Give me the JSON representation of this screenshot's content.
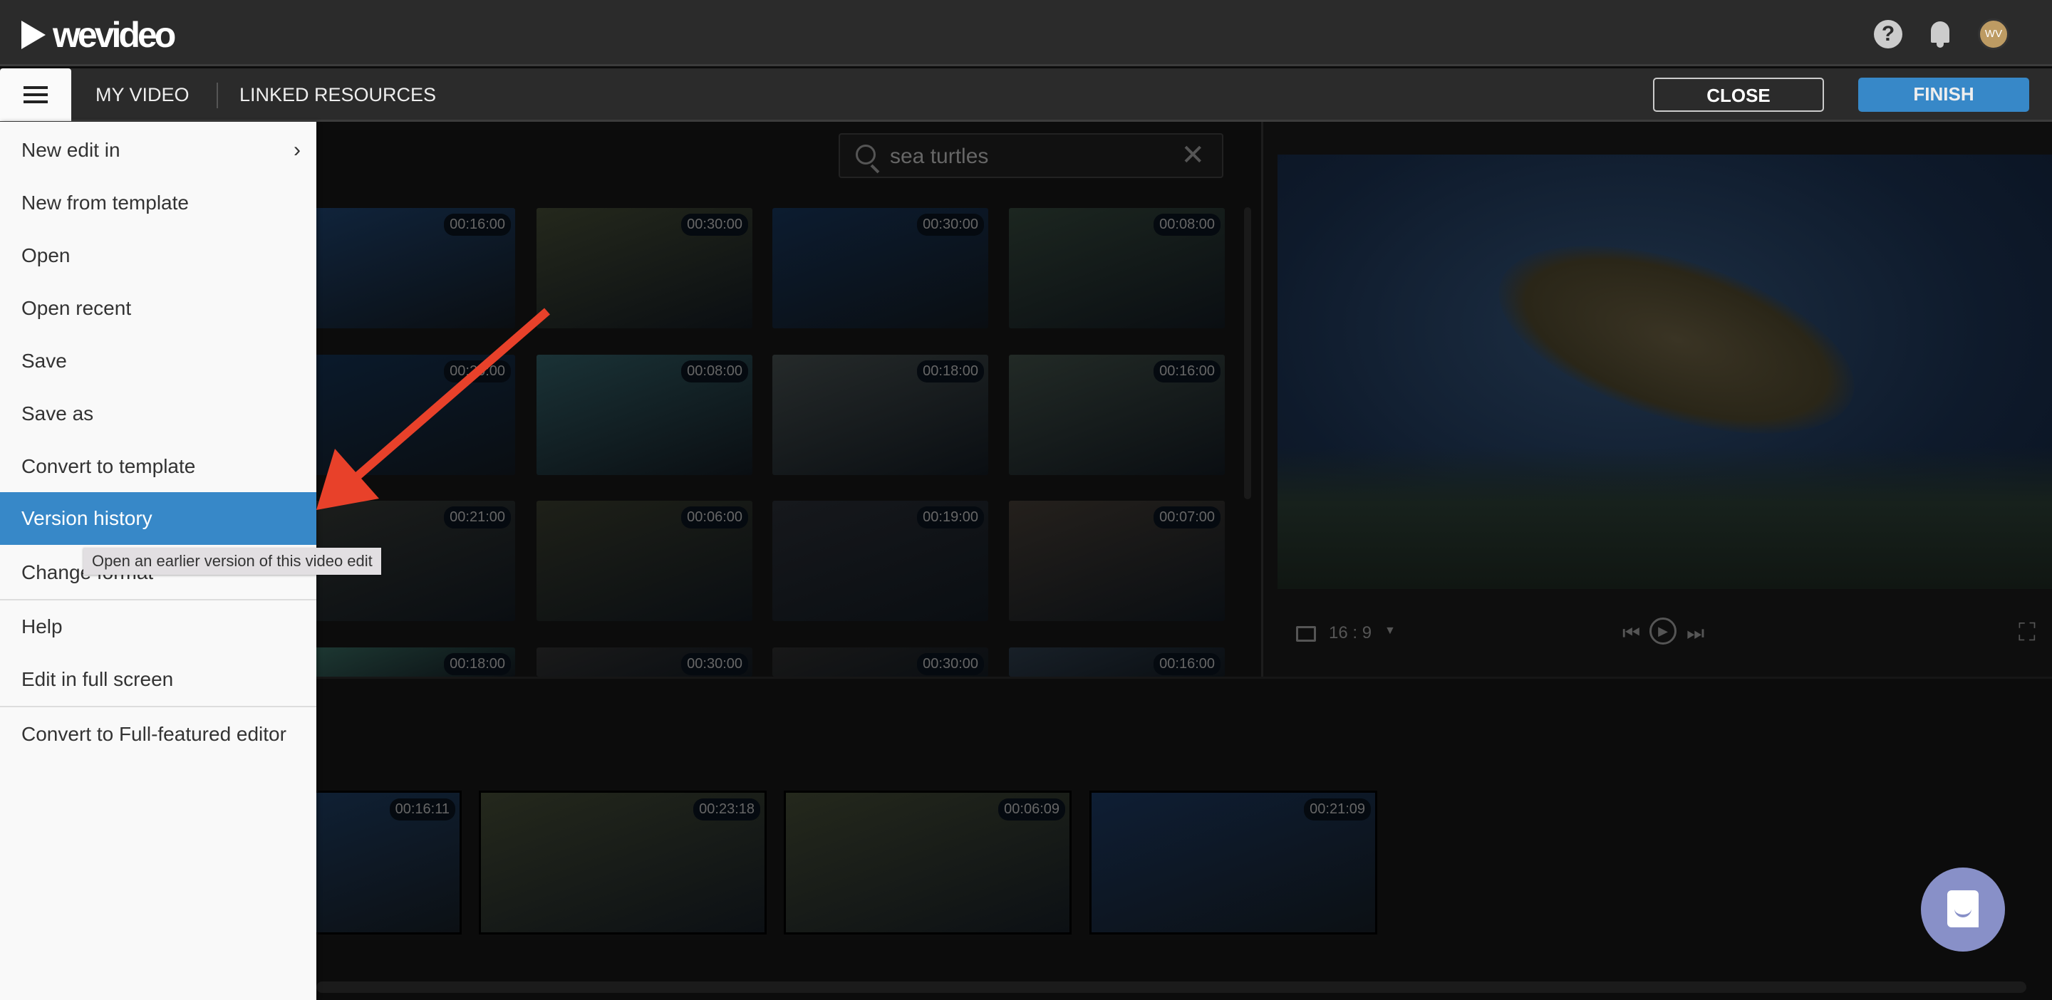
{
  "header": {
    "logo": "wevideo",
    "avatar_initials": "WV",
    "icons": [
      "help-icon",
      "bell-icon"
    ]
  },
  "nav": {
    "tabs": [
      "MY VIDEO",
      "LINKED RESOURCES"
    ],
    "close_label": "CLOSE",
    "finish_label": "FINISH"
  },
  "search": {
    "value": "sea turtles"
  },
  "media": {
    "durations": [
      [
        "00:16:00",
        "00:30:00",
        "00:30:00",
        "00:08:00"
      ],
      [
        "00:20:00",
        "00:08:00",
        "00:18:00",
        "00:16:00"
      ],
      [
        "00:21:00",
        "00:06:00",
        "00:19:00",
        "00:07:00"
      ],
      [
        "00:18:00",
        "00:30:00",
        "00:30:00",
        "00:16:00"
      ]
    ]
  },
  "preview": {
    "aspect": "16 : 9"
  },
  "timeline": {
    "clips": [
      "00:16:11",
      "00:23:18",
      "00:06:09",
      "00:21:09"
    ]
  },
  "menu": {
    "items": [
      "New edit in",
      "New from template",
      "Open",
      "Open recent",
      "Save",
      "Save as",
      "Convert to template",
      "Version history",
      "Change format",
      "Help",
      "Edit in full screen",
      "Convert to Full-featured editor"
    ],
    "active": "Version history",
    "tooltip": "Open an earlier version of this video edit"
  },
  "colors": {
    "accent": "#3788c8",
    "annotation_arrow": "#e8412a",
    "chat": "#8890c8"
  }
}
